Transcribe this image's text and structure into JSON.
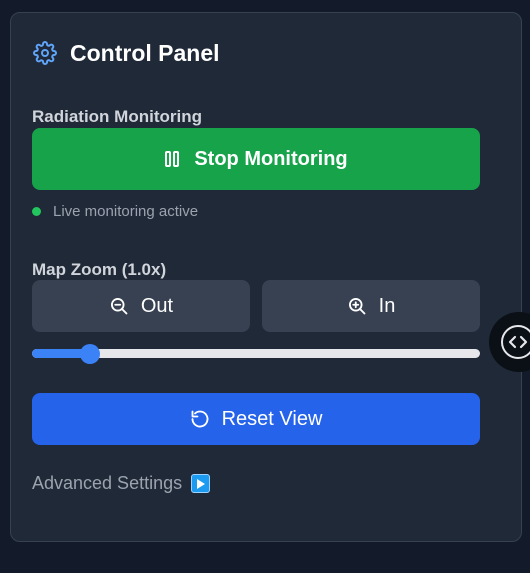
{
  "panel": {
    "title": "Control Panel",
    "title_icon": "gear-icon"
  },
  "radiation": {
    "label": "Radiation Monitoring",
    "button_label": "Stop Monitoring",
    "button_icon": "pause-icon",
    "status_text": "Live monitoring active"
  },
  "zoom": {
    "label": "Map Zoom (1.0x)",
    "out_label": "Out",
    "in_label": "In",
    "value": 1.0,
    "slider_fraction": 0.13
  },
  "reset": {
    "label": "Reset View",
    "icon": "rotate-ccw-icon"
  },
  "advanced": {
    "label": "Advanced Settings",
    "icon": "play-icon"
  },
  "colors": {
    "background": "#131b2b",
    "panel": "#1f2937",
    "success": "#16a34a",
    "primary": "#2563eb",
    "secondary": "#374151",
    "accent": "#3b82f6",
    "status_dot": "#22c55e"
  }
}
